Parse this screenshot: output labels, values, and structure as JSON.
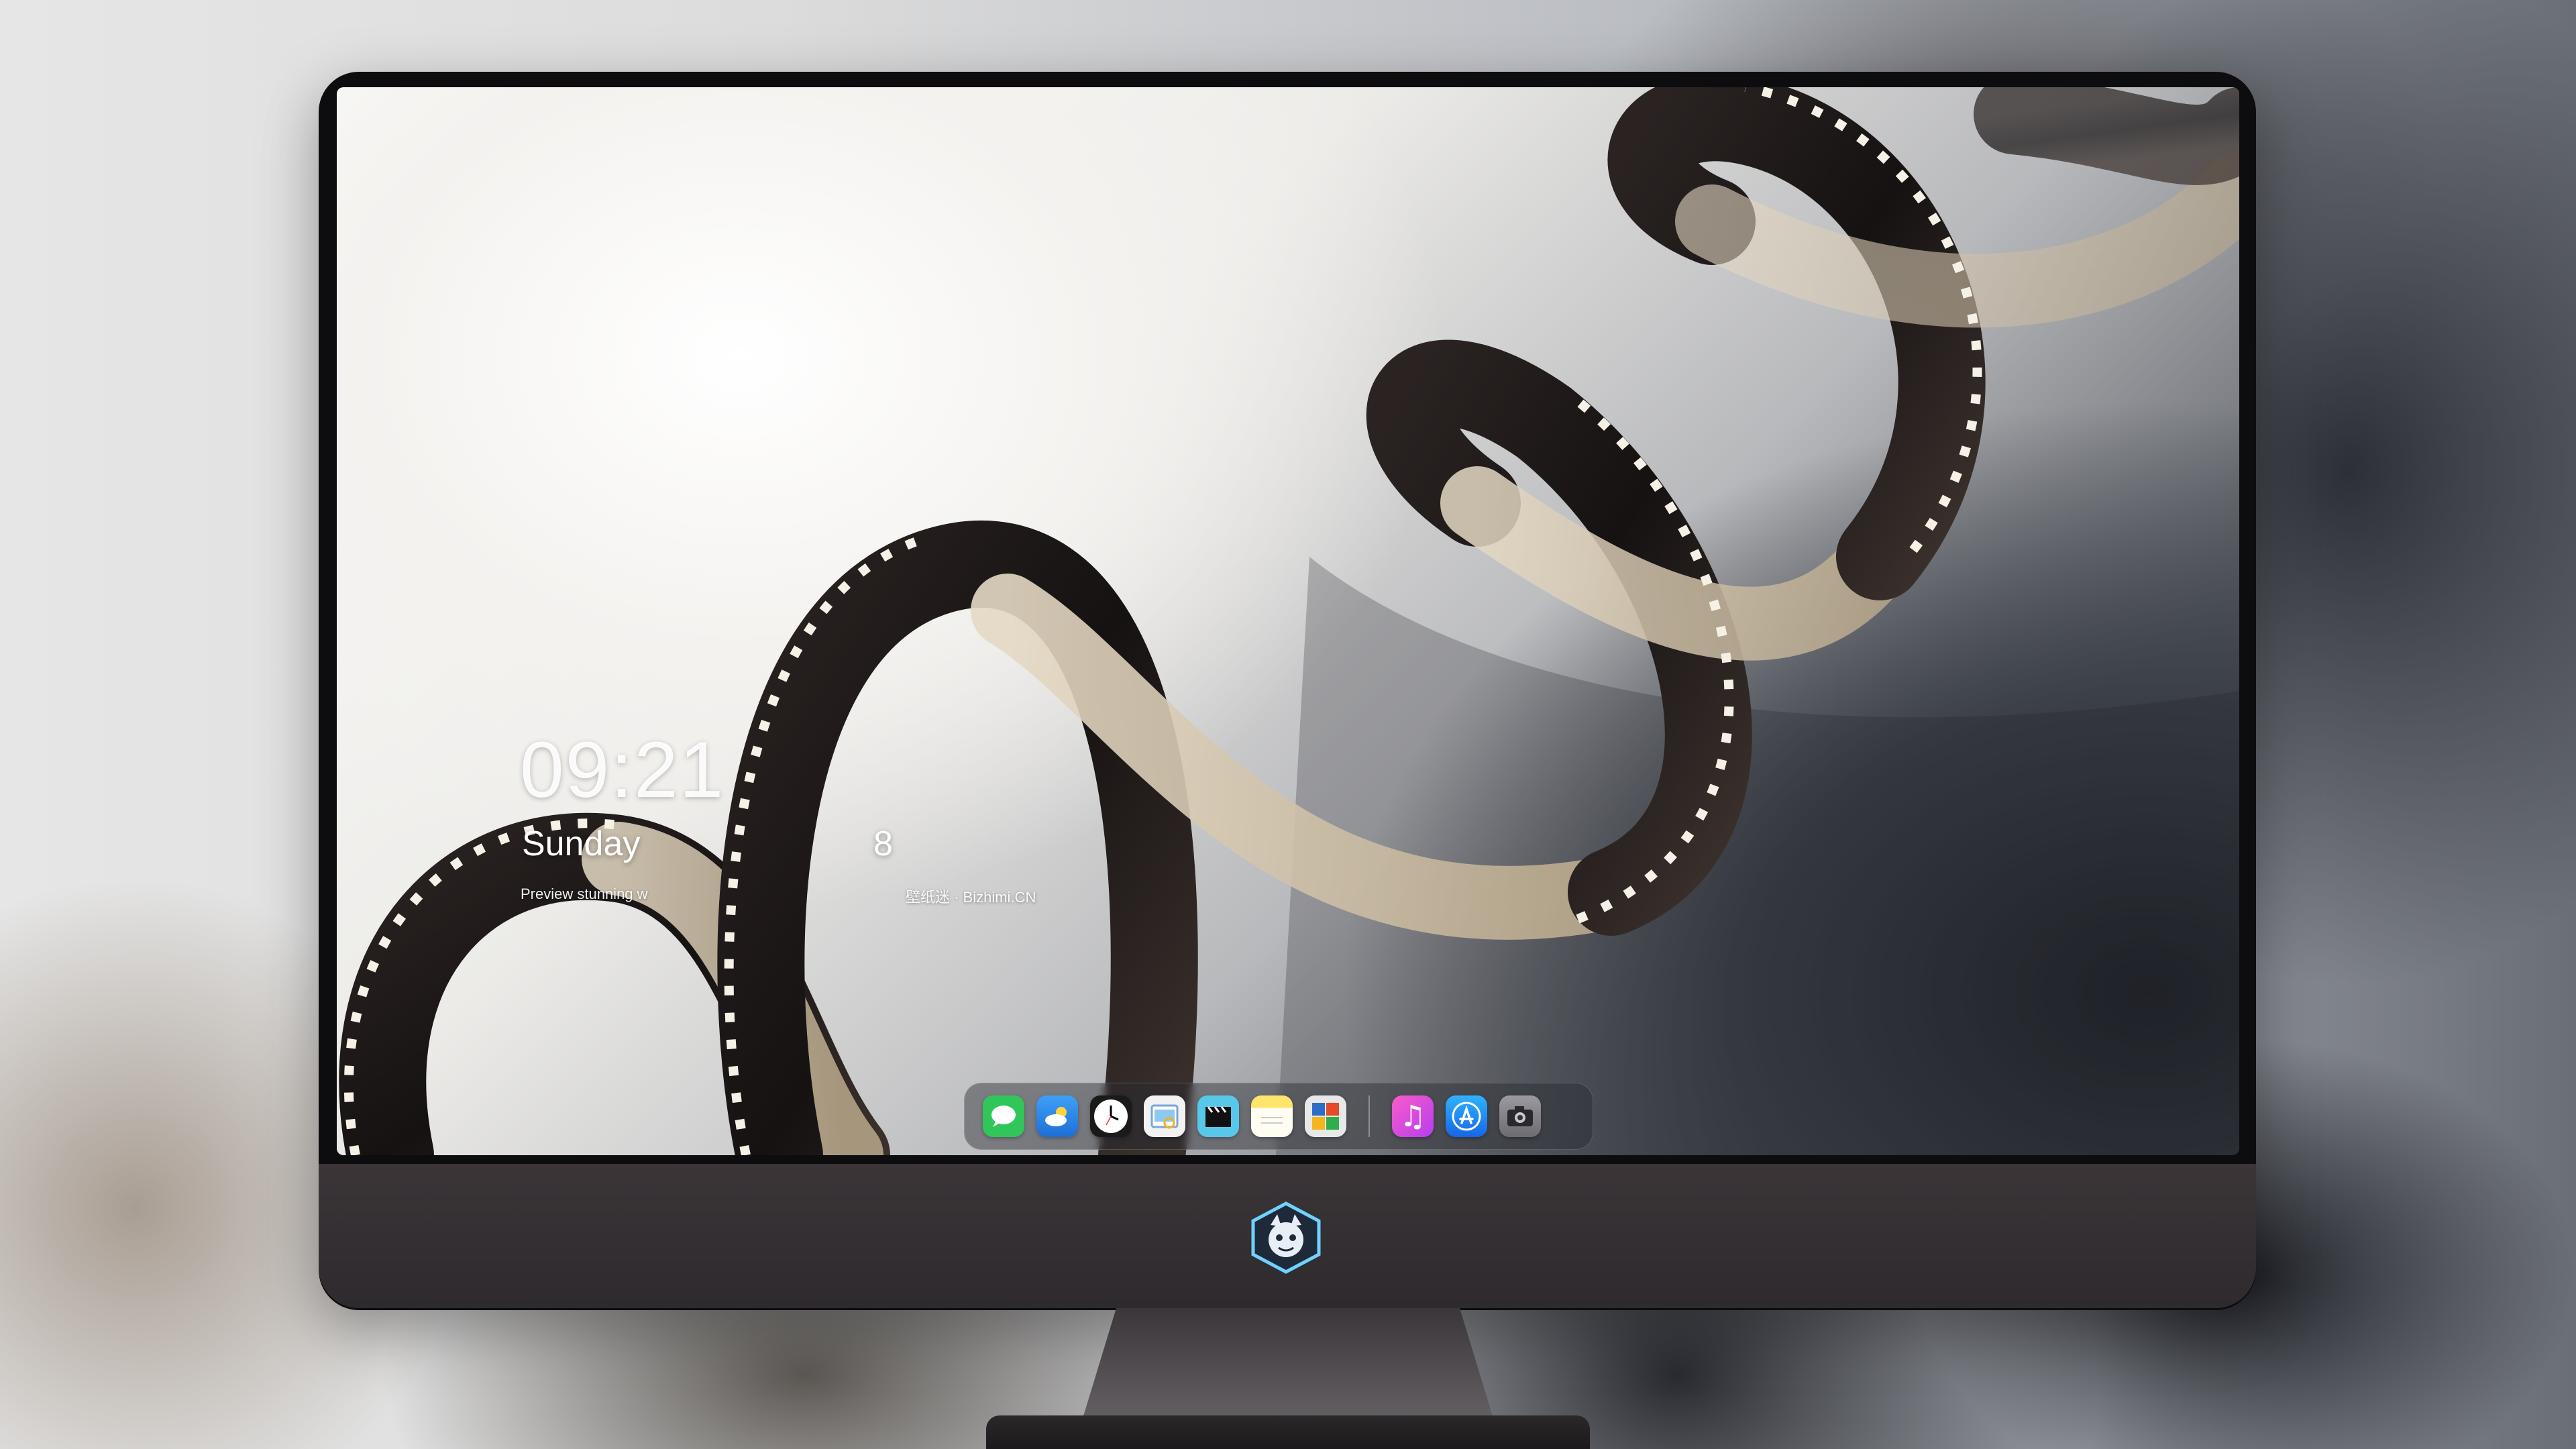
{
  "overlay": {
    "clock_fragment": "09:21",
    "date_left": "Sunday",
    "date_right": "8",
    "preview_left": "Preview stunning w",
    "preview_right": "壁纸迷 · Bizhimi.CN"
  },
  "dock": {
    "apps_left": [
      {
        "name": "messages",
        "icon": "messages-icon",
        "color": "#31c65a"
      },
      {
        "name": "weather",
        "icon": "weather-icon",
        "color": "#2f8ff0"
      },
      {
        "name": "clock",
        "icon": "clock-icon",
        "color": "#ffffff"
      },
      {
        "name": "preview",
        "icon": "preview-icon",
        "color": "#f2f2f2"
      },
      {
        "name": "claquette",
        "icon": "claquette-icon",
        "color": "#58c8ea"
      },
      {
        "name": "notes",
        "icon": "notes-icon",
        "color": "#ffd43b"
      },
      {
        "name": "photo-booth",
        "icon": "photo-booth-icon",
        "color": "#2e6cc9"
      }
    ],
    "apps_right": [
      {
        "name": "itunes",
        "icon": "music-icon",
        "color": "#e84ad9"
      },
      {
        "name": "app-store",
        "icon": "app-store-icon",
        "color": "#1c8ef5"
      },
      {
        "name": "camera",
        "icon": "camera-icon",
        "color": "#8a8a8e"
      }
    ]
  },
  "monitor": {
    "logo": "dragon-logo-icon"
  }
}
